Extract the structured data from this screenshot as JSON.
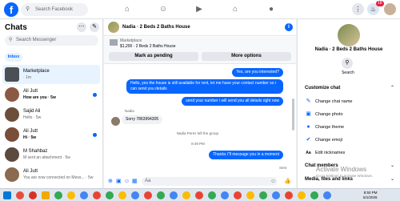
{
  "topbar": {
    "logo": "f",
    "search_placeholder": "Search Facebook",
    "nav_icons": [
      "home-icon",
      "friends-icon",
      "video-icon",
      "marketplace-icon",
      "groups-icon"
    ],
    "notifications_count": "18"
  },
  "left": {
    "title": "Chats",
    "search_placeholder": "Search Messenger",
    "inbox_tab": "Inbox",
    "chats": [
      {
        "name": "Marketplace",
        "preview": "· 1m",
        "active": true,
        "avatar_color": "#4b4f56"
      },
      {
        "name": "Ali Jutt",
        "preview": "How are you · 5w",
        "unread": true,
        "avatar_color": "#8a5a44"
      },
      {
        "name": "Sajid Ali",
        "preview": "Hello · 5w",
        "unread": false,
        "avatar_color": "#6b4f3a"
      },
      {
        "name": "Ali Jutt",
        "preview": "Hi · 5w",
        "unread": true,
        "avatar_color": "#7a4e38"
      },
      {
        "name": "M Shahbaz",
        "preview": "M sent an attachment · 5w",
        "unread": false,
        "avatar_color": "#5c4a3e"
      },
      {
        "name": "Ali Jutt",
        "preview": "You are now connected on Mess... · 5w",
        "unread": false,
        "avatar_color": "#8b6a4f"
      }
    ]
  },
  "chat": {
    "title": "Nadia · 2 Beds 2 Baths House",
    "marketplace_label": "Marketplace",
    "listing": "$1,200 · 2 Beds 2 Baths House",
    "mark_pending": "Mark as pending",
    "more_options": "More options",
    "messages": [
      {
        "dir": "out",
        "text": "Yes, are you interested?"
      },
      {
        "dir": "out",
        "text": "Hello, yes the house is still available for rent, let me have your contact number so i can send you details"
      },
      {
        "dir": "out",
        "text": "send your number i will send you all details right now"
      },
      {
        "dir": "sender",
        "text": "Nadia"
      },
      {
        "dir": "in",
        "text": "Sorry 7863994305"
      },
      {
        "dir": "sys",
        "text": "Nadia Perez left the group."
      },
      {
        "dir": "sys",
        "text": "8:49 PM"
      },
      {
        "dir": "out",
        "text": "Thanks i\"ll message you in a moment"
      },
      {
        "dir": "sys",
        "text": "Sent"
      }
    ],
    "composer_placeholder": "Aa"
  },
  "right": {
    "name": "Nadia · 2 Beds 2 Baths House",
    "search_label": "Search",
    "customize_heading": "Customize chat",
    "options": [
      {
        "icon": "pencil-icon",
        "label": "Change chat name"
      },
      {
        "icon": "photo-icon",
        "label": "Change photo"
      },
      {
        "icon": "theme-icon",
        "label": "Change theme"
      },
      {
        "icon": "like-icon",
        "label": "Change emoji"
      },
      {
        "icon": "nickname-icon",
        "label": "Edit nicknames"
      }
    ],
    "members_heading": "Chat members",
    "media_heading": "Media, files and links"
  },
  "watermark": {
    "line1": "Activate Windows",
    "line2": "Go to Settings to activate Windows."
  },
  "taskbar": {
    "time": "8:50 PM",
    "date": "5/1/2025"
  },
  "colors": {
    "accent": "#0866ff",
    "background": "#f0f2f5"
  }
}
